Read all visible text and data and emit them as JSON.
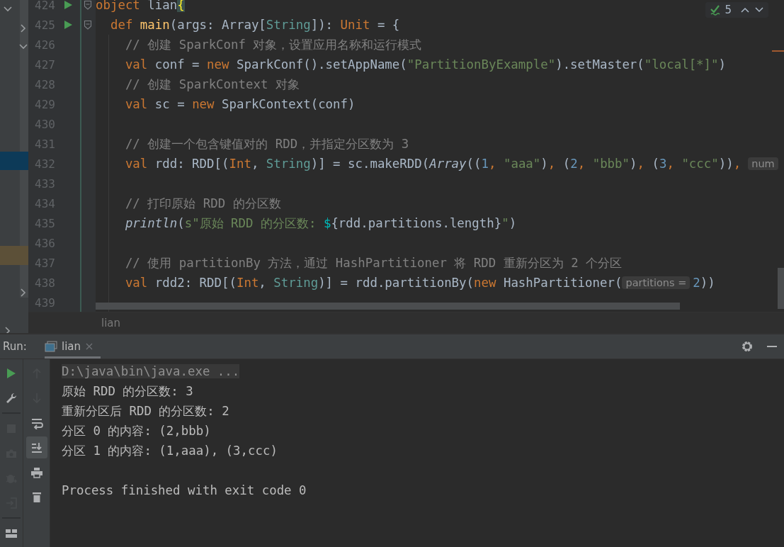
{
  "project_tree": {
    "rows": [
      {
        "expanded": true,
        "selected": false,
        "highlighted": false,
        "children": [
          {
            "expanded": false,
            "selected": false,
            "highlighted": false
          },
          {
            "expanded": true,
            "selected": false,
            "highlighted": false
          },
          {
            "selected": false,
            "highlighted": false
          },
          {
            "selected": false,
            "highlighted": false
          },
          {
            "selected": false,
            "highlighted": false
          },
          {
            "selected": false,
            "highlighted": false
          },
          {
            "selected": false,
            "highlighted": false
          },
          {
            "selected": true,
            "highlighted": false
          },
          {
            "selected": false,
            "highlighted": false
          },
          {
            "selected": false,
            "highlighted": false
          },
          {
            "selected": false,
            "highlighted": false
          },
          {
            "selected": false,
            "highlighted": false
          },
          {
            "selected": false,
            "highlighted": true
          },
          {
            "selected": false,
            "highlighted": false
          },
          {
            "expanded": false,
            "selected": false,
            "highlighted": false
          },
          {
            "selected": false,
            "highlighted": false
          }
        ]
      },
      {
        "expanded": false,
        "selected": false,
        "highlighted": false
      }
    ]
  },
  "editor": {
    "inspection": {
      "count": "5"
    },
    "lines": [
      {
        "number": "424",
        "gutter": [
          {
            "kind": "run"
          },
          {
            "kind": "fold"
          }
        ],
        "tokens": [
          {
            "kind": "keyword",
            "text": "object"
          },
          {
            "kind": "plain",
            "text": " lian"
          },
          {
            "kind": "brace",
            "text": "{"
          }
        ],
        "children": [
          {
            "number": "425",
            "gutter": [
              {
                "kind": "run"
              },
              {
                "kind": "fold"
              }
            ],
            "tokens": [
              {
                "kind": "keyword",
                "text": "def"
              },
              {
                "kind": "function",
                "text": " main"
              },
              {
                "kind": "plain",
                "text": "(args: Array["
              },
              {
                "kind": "type",
                "text": "String"
              },
              {
                "kind": "plain",
                "text": "]): "
              },
              {
                "kind": "keyword",
                "text": "Unit"
              },
              {
                "kind": "plain",
                "text": " = {"
              }
            ],
            "children": [
              {
                "number": "426",
                "tokens": [
                  {
                    "kind": "comment",
                    "text": "// 创建 SparkConf 对象，设置应用名称和运行模式"
                  }
                ]
              },
              {
                "number": "427",
                "tokens": [
                  {
                    "kind": "keyword",
                    "text": "val"
                  },
                  {
                    "kind": "plain",
                    "text": " conf = "
                  },
                  {
                    "kind": "keyword",
                    "text": "new"
                  },
                  {
                    "kind": "plain",
                    "text": " SparkConf().setAppName("
                  },
                  {
                    "kind": "string",
                    "text": "\"PartitionByExample\""
                  },
                  {
                    "kind": "plain",
                    "text": ").setMaster("
                  },
                  {
                    "kind": "string",
                    "text": "\"local[*]\""
                  },
                  {
                    "kind": "plain",
                    "text": ")"
                  }
                ]
              },
              {
                "number": "428",
                "tokens": [
                  {
                    "kind": "comment",
                    "text": "// 创建 SparkContext 对象"
                  }
                ]
              },
              {
                "number": "429",
                "tokens": [
                  {
                    "kind": "keyword",
                    "text": "val"
                  },
                  {
                    "kind": "plain",
                    "text": " sc = "
                  },
                  {
                    "kind": "keyword",
                    "text": "new"
                  },
                  {
                    "kind": "plain",
                    "text": " SparkContext(conf)"
                  }
                ]
              },
              {
                "number": "430"
              },
              {
                "number": "431",
                "tokens": [
                  {
                    "kind": "comment",
                    "text": "// 创建一个包含键值对的 RDD，并指定分区数为 3"
                  }
                ]
              },
              {
                "number": "432",
                "tokens": [
                  {
                    "kind": "keyword",
                    "text": "val"
                  },
                  {
                    "kind": "plain",
                    "text": " rdd: RDD[("
                  },
                  {
                    "kind": "keyword",
                    "text": "Int"
                  },
                  {
                    "kind": "plain",
                    "text": ", "
                  },
                  {
                    "kind": "type",
                    "text": "String"
                  },
                  {
                    "kind": "plain",
                    "text": ")] = sc.makeRDD("
                  },
                  {
                    "kind": "italic",
                    "text": "Array"
                  },
                  {
                    "kind": "plain",
                    "text": "(("
                  },
                  {
                    "kind": "number",
                    "text": "1"
                  },
                  {
                    "kind": "keyword",
                    "text": ", "
                  },
                  {
                    "kind": "string",
                    "text": "\"aaa\""
                  },
                  {
                    "kind": "plain",
                    "text": ")"
                  },
                  {
                    "kind": "keyword",
                    "text": ", "
                  },
                  {
                    "kind": "plain",
                    "text": "("
                  },
                  {
                    "kind": "number",
                    "text": "2"
                  },
                  {
                    "kind": "keyword",
                    "text": ", "
                  },
                  {
                    "kind": "string",
                    "text": "\"bbb\""
                  },
                  {
                    "kind": "plain",
                    "text": ")"
                  },
                  {
                    "kind": "keyword",
                    "text": ", "
                  },
                  {
                    "kind": "plain",
                    "text": "("
                  },
                  {
                    "kind": "number",
                    "text": "3"
                  },
                  {
                    "kind": "keyword",
                    "text": ", "
                  },
                  {
                    "kind": "string",
                    "text": "\"ccc\""
                  },
                  {
                    "kind": "plain",
                    "text": "))"
                  },
                  {
                    "kind": "keyword",
                    "text": ","
                  },
                  {
                    "kind": "hint",
                    "text": "num"
                  }
                ]
              },
              {
                "number": "433"
              },
              {
                "number": "434",
                "tokens": [
                  {
                    "kind": "comment",
                    "text": "// 打印原始 RDD 的分区数"
                  }
                ]
              },
              {
                "number": "435",
                "tokens": [
                  {
                    "kind": "italic",
                    "text": "println"
                  },
                  {
                    "kind": "plain",
                    "text": "("
                  },
                  {
                    "kind": "string",
                    "text": "s\"原始 RDD 的分区数: "
                  },
                  {
                    "kind": "interpolation",
                    "text": "$"
                  },
                  {
                    "kind": "plain",
                    "text": "{rdd.partitions.length}"
                  },
                  {
                    "kind": "string",
                    "text": "\""
                  },
                  {
                    "kind": "plain",
                    "text": ")"
                  }
                ]
              },
              {
                "number": "436"
              },
              {
                "number": "437",
                "tokens": [
                  {
                    "kind": "comment",
                    "text": "// 使用 partitionBy 方法，通过 HashPartitioner 将 RDD 重新分区为 2 个分区"
                  }
                ]
              },
              {
                "number": "438",
                "tokens": [
                  {
                    "kind": "keyword",
                    "text": "val"
                  },
                  {
                    "kind": "plain",
                    "text": " rdd2: RDD[("
                  },
                  {
                    "kind": "keyword",
                    "text": "Int"
                  },
                  {
                    "kind": "plain",
                    "text": ", "
                  },
                  {
                    "kind": "type",
                    "text": "String"
                  },
                  {
                    "kind": "plain",
                    "text": ")] = rdd.partitionBy("
                  },
                  {
                    "kind": "keyword",
                    "text": "new"
                  },
                  {
                    "kind": "plain",
                    "text": " HashPartitioner("
                  },
                  {
                    "kind": "hint",
                    "text": "partitions ="
                  },
                  {
                    "kind": "number",
                    "text": "2"
                  },
                  {
                    "kind": "plain",
                    "text": "))"
                  }
                ]
              },
              {
                "number": "439"
              }
            ]
          }
        ]
      }
    ],
    "breadcrumb": "lian"
  },
  "run_panel": {
    "label": "Run:",
    "tabs": [
      {
        "label": "lian",
        "selected": true
      }
    ],
    "left_toolbar": [
      {
        "kind": "rerun",
        "disabled": false
      },
      {
        "kind": "wrench",
        "disabled": false
      },
      {
        "kind": "separator"
      },
      {
        "kind": "stop",
        "disabled": true
      },
      {
        "kind": "camera",
        "disabled": true
      },
      {
        "kind": "bug",
        "disabled": true
      },
      {
        "kind": "exit",
        "disabled": true
      },
      {
        "kind": "separator"
      },
      {
        "kind": "layout",
        "disabled": false
      }
    ],
    "console_toolbar": [
      {
        "kind": "up",
        "disabled": true,
        "selected": false
      },
      {
        "kind": "down",
        "disabled": true,
        "selected": false
      },
      {
        "kind": "wrap",
        "disabled": false,
        "selected": false
      },
      {
        "kind": "scroll-end",
        "disabled": false,
        "selected": true
      },
      {
        "kind": "print",
        "disabled": false,
        "selected": false
      },
      {
        "kind": "trash",
        "disabled": false,
        "selected": false
      }
    ],
    "console": [
      {
        "kind": "command",
        "text": "D:\\java\\bin\\java.exe ..."
      },
      {
        "kind": "output",
        "text": "原始 RDD 的分区数: 3"
      },
      {
        "kind": "output",
        "text": "重新分区后 RDD 的分区数: 2"
      },
      {
        "kind": "output",
        "text": "分区 0 的内容: (2,bbb)"
      },
      {
        "kind": "output",
        "text": "分区 1 的内容: (1,aaa), (3,ccc)"
      },
      {
        "kind": "blank"
      },
      {
        "kind": "output",
        "text": "Process finished with exit code 0"
      }
    ]
  }
}
